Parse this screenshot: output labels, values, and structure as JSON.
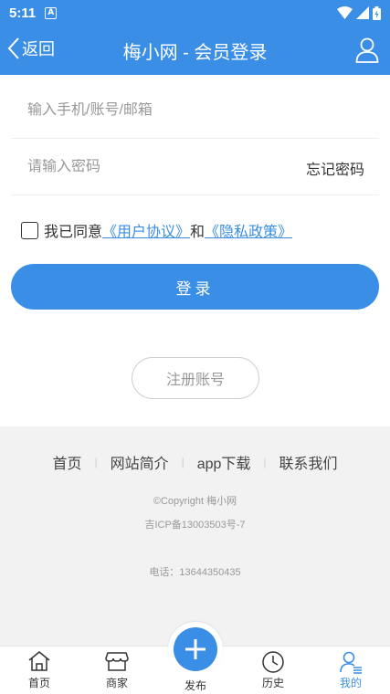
{
  "status_bar": {
    "time": "5:11",
    "app_icon_letter": "A"
  },
  "header": {
    "back_label": "返回",
    "title": "梅小网 - 会员登录"
  },
  "form": {
    "account_placeholder": "输入手机/账号/邮箱",
    "password_placeholder": "请输入密码",
    "forgot_label": "忘记密码",
    "agree_text": "我已同意",
    "user_agreement": "《用户协议》",
    "and_text": "和",
    "privacy_policy": "《隐私政策》",
    "login_label": "登录",
    "register_label": "注册账号"
  },
  "footer": {
    "links": [
      "首页",
      "网站简介",
      "app下载",
      "联系我们"
    ],
    "copyright": "©Copyright  梅小网",
    "icp": "吉ICP备13003503号-7",
    "phone": "电话：13644350435"
  },
  "tabbar": {
    "items": [
      {
        "label": "首页",
        "icon": "home-icon"
      },
      {
        "label": "商家",
        "icon": "shop-icon"
      },
      {
        "label": "发布",
        "icon": "plus-icon"
      },
      {
        "label": "历史",
        "icon": "clock-icon"
      },
      {
        "label": "我的",
        "icon": "user-icon"
      }
    ]
  },
  "colors": {
    "accent": "#3a8ee6",
    "footer_bg": "#f2f2f2"
  }
}
